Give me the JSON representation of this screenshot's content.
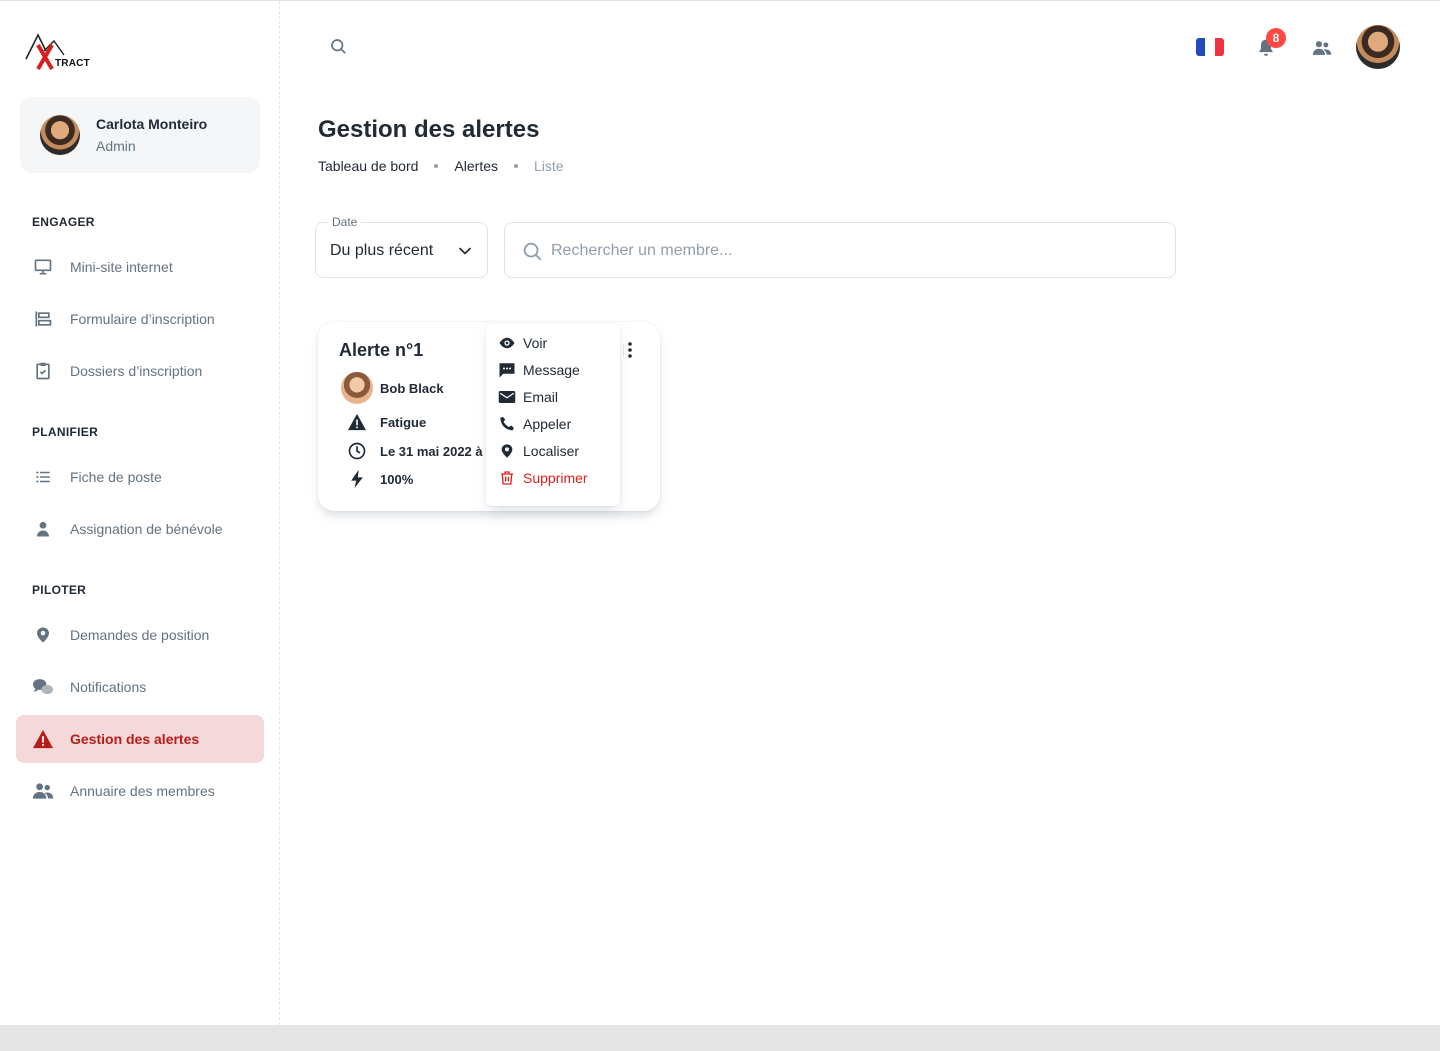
{
  "brand": {
    "logo_text": "TRACT"
  },
  "account": {
    "name": "Carlota Monteiro",
    "role": "Admin"
  },
  "sidebar": {
    "sections": [
      {
        "title": "ENGAGER",
        "items": [
          {
            "label": "Mini-site internet",
            "icon": "monitor-icon"
          },
          {
            "label": "Formulaire d’inscription",
            "icon": "form-icon"
          },
          {
            "label": "Dossiers d’inscription",
            "icon": "clipboard-check-icon"
          }
        ]
      },
      {
        "title": "PLANIFIER",
        "items": [
          {
            "label": "Fiche de poste",
            "icon": "list-icon"
          },
          {
            "label": "Assignation de bénévole",
            "icon": "person-icon"
          }
        ]
      },
      {
        "title": "PILOTER",
        "items": [
          {
            "label": "Demandes de position",
            "icon": "map-pin-icon"
          },
          {
            "label": "Notifications",
            "icon": "chat-bubbles-icon"
          },
          {
            "label": "Gestion des alertes",
            "icon": "alert-triangle-icon",
            "active": true
          },
          {
            "label": "Annuaire des membres",
            "icon": "users-icon"
          }
        ]
      }
    ]
  },
  "header": {
    "notification_count": "8",
    "language": "FR"
  },
  "page": {
    "title": "Gestion des alertes",
    "breadcrumbs": [
      "Tableau de bord",
      "Alertes",
      "Liste"
    ]
  },
  "filters": {
    "date_label": "Date",
    "date_value": "Du plus récent",
    "search_placeholder": "Rechercher un membre..."
  },
  "card": {
    "title": "Alerte n°1",
    "user": "Bob Black",
    "type": "Fatigue",
    "date": "Le 31 mai 2022 à",
    "level": "100%"
  },
  "menu": {
    "items": [
      "Voir",
      "Message",
      "Email",
      "Appeler",
      "Localiser",
      "Supprimer"
    ]
  },
  "colors": {
    "accent": "#b71d18",
    "active_bg": "#f5d8da",
    "danger": "#e0201a",
    "badge": "#ff4842"
  }
}
